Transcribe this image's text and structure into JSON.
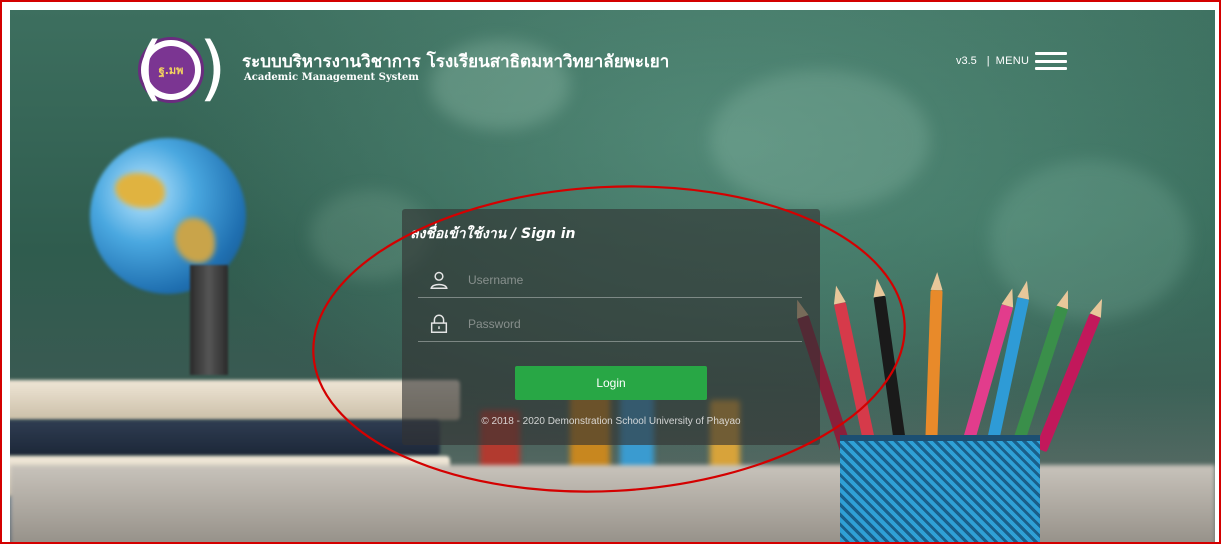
{
  "header": {
    "logo_text": "ฐ.มพ",
    "title_th": "ระบบบริหารงานวิชาการ โรงเรียนสาธิตมหาวิทยาลัยพะเยา",
    "title_en": "Academic Management System",
    "version": "v3.5",
    "separator": "|",
    "menu_label": "MENU"
  },
  "login": {
    "title": "ลงชื่อเข้าใช้งาน / Sign in",
    "username_placeholder": "Username",
    "password_placeholder": "Password",
    "button_label": "Login",
    "copyright": "© 2018 - 2020 Demonstration School University of Phayao"
  },
  "colors": {
    "button": "#28a745",
    "annotation": "#d40000",
    "panel": "rgba(50,50,50,0.62)"
  },
  "icons": [
    "user-icon",
    "lock-icon",
    "hamburger-menu-icon"
  ]
}
